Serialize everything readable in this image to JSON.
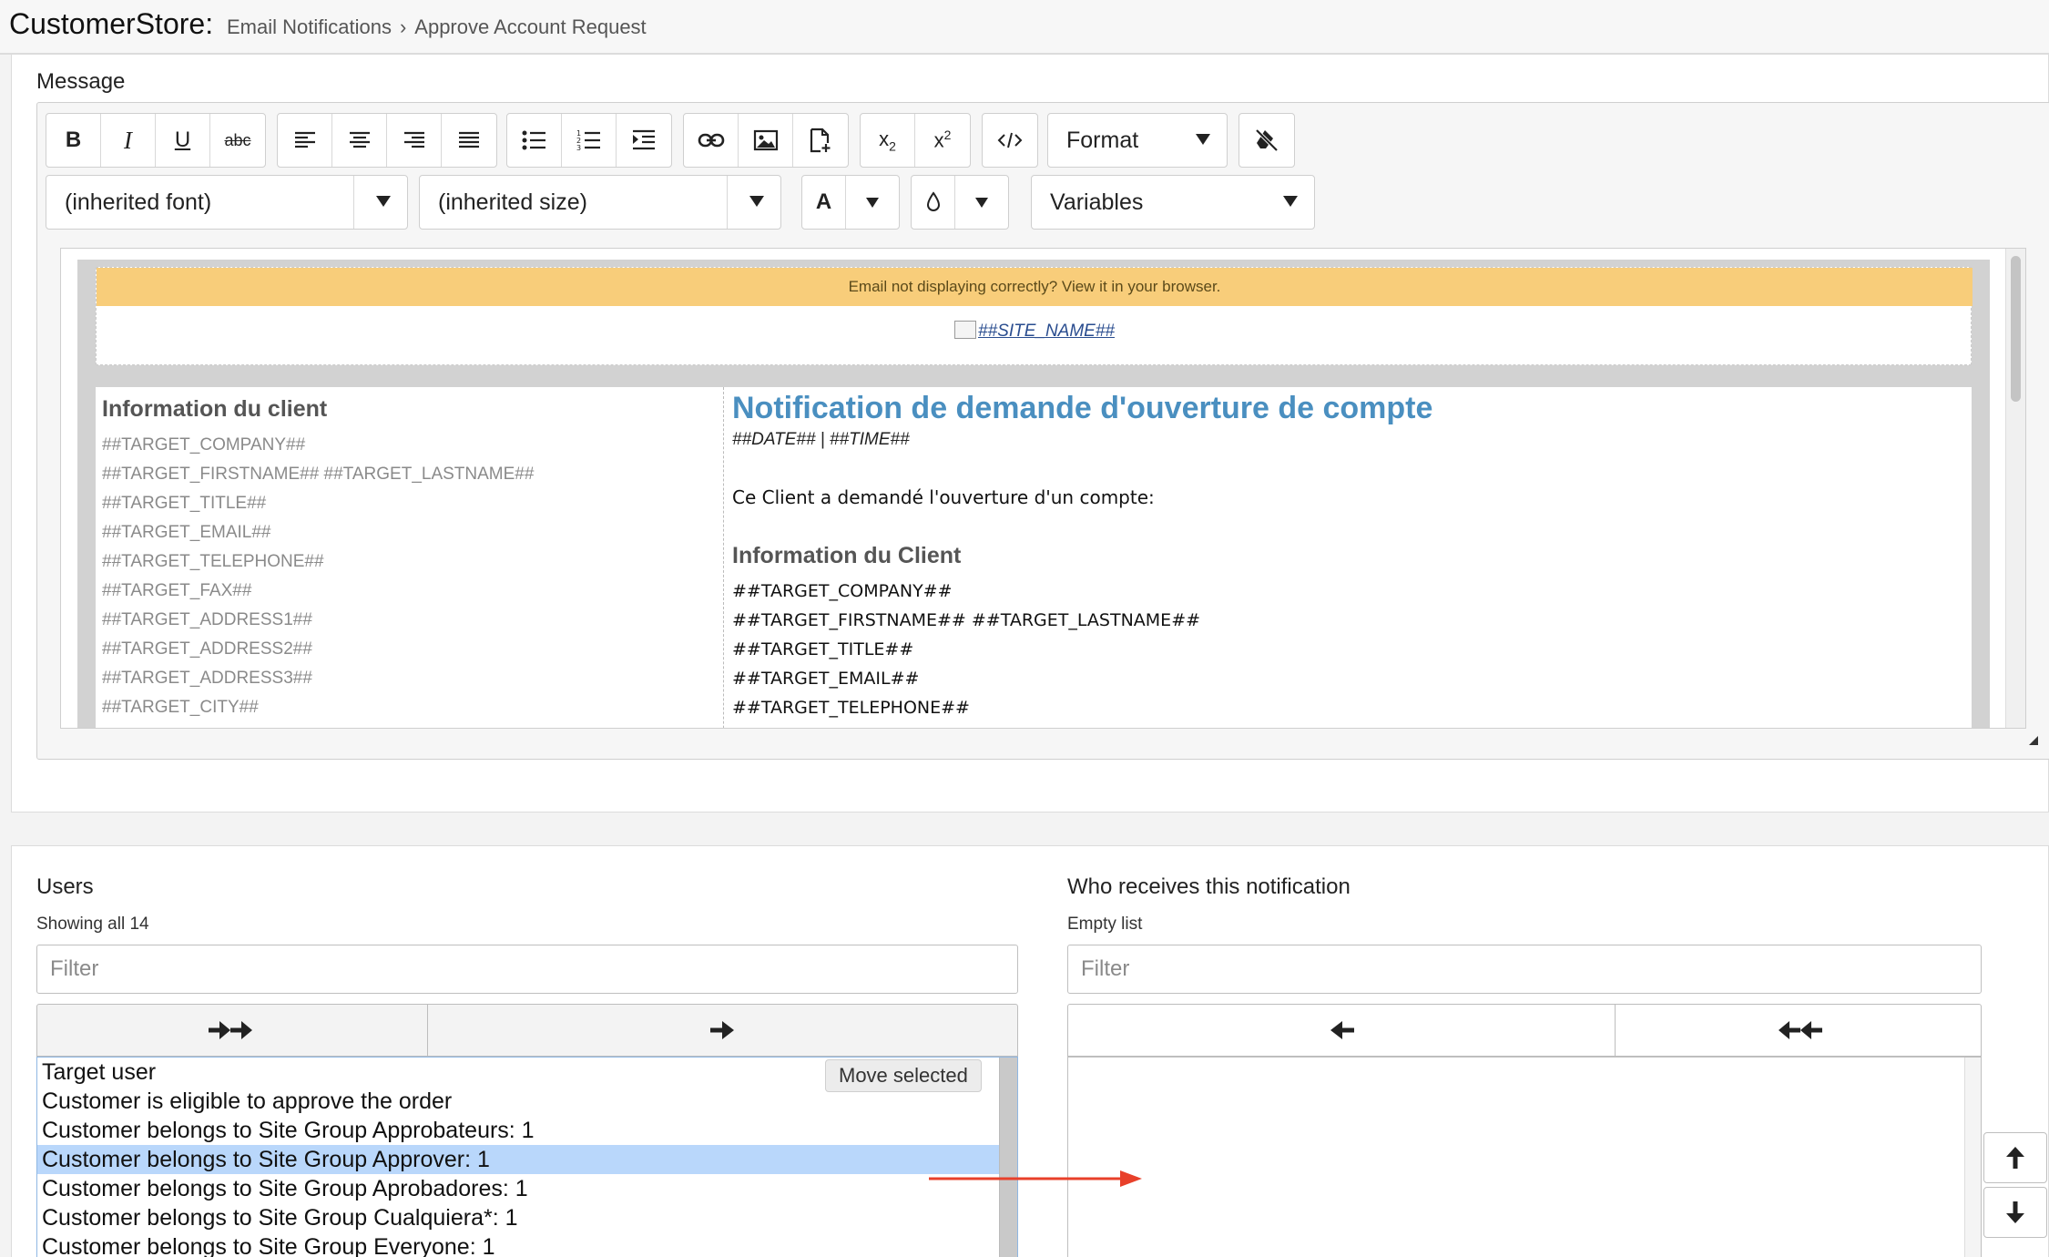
{
  "header": {
    "app_title": "CustomerStore:",
    "breadcrumb": [
      "Email Notifications",
      "Approve Account Request"
    ]
  },
  "message": {
    "label": "Message",
    "toolbar": {
      "format_label": "Format",
      "font_select": "(inherited font)",
      "size_select": "(inherited size)",
      "text_color_label": "A",
      "variables_select": "Variables",
      "icons": [
        "bold-icon",
        "italic-icon",
        "underline-icon",
        "strikethrough-icon",
        "align-left-icon",
        "align-center-icon",
        "align-right-icon",
        "align-justify-icon",
        "bullet-list-icon",
        "numbered-list-icon",
        "indent-icon",
        "link-icon",
        "image-icon",
        "insert-file-icon",
        "subscript-icon",
        "superscript-icon",
        "code-icon",
        "clear-formatting-icon",
        "text-color-icon",
        "background-color-icon"
      ]
    },
    "content": {
      "banner": "Email not displaying correctly? View it in your browser.",
      "site_name": "##SITE_NAME##",
      "left_title": "Information du client",
      "left_lines": [
        "##TARGET_COMPANY##",
        "##TARGET_FIRSTNAME## ##TARGET_LASTNAME##",
        "##TARGET_TITLE##",
        "##TARGET_EMAIL##",
        "##TARGET_TELEPHONE##",
        "##TARGET_FAX##",
        "##TARGET_ADDRESS1##",
        "##TARGET_ADDRESS2##",
        "##TARGET_ADDRESS3##",
        "##TARGET_CITY##"
      ],
      "notif_title": "Notification de demande d'ouverture de compte",
      "date_line": "##DATE## | ##TIME##",
      "body_text": "Ce Client a demandé l'ouverture d'un compte:",
      "right_title": "Information du Client",
      "right_lines": [
        "##TARGET_COMPANY##",
        "##TARGET_FIRSTNAME## ##TARGET_LASTNAME##",
        "##TARGET_TITLE##",
        "##TARGET_EMAIL##",
        "##TARGET_TELEPHONE##"
      ]
    }
  },
  "users": {
    "label": "Users",
    "count_text": "Showing all 14",
    "filter_placeholder": "Filter",
    "tooltip": "Move selected",
    "items": [
      "Target user",
      "Customer is eligible to approve the order",
      "Customer belongs to Site Group Approbateurs: 1",
      "Customer belongs to Site Group Approver: 1",
      "Customer belongs to Site Group Aprobadores: 1",
      "Customer belongs to Site Group Cualquiera*: 1",
      "Customer belongs to Site Group Everyone: 1"
    ],
    "selected_index": 3
  },
  "receivers": {
    "label": "Who receives this notification",
    "count_text": "Empty list",
    "filter_placeholder": "Filter"
  },
  "colors": {
    "accent": "#4a8fc0",
    "banner": "#f8cd7a",
    "selection": "#b9d7fb",
    "annotation_arrow": "#e8402a"
  }
}
